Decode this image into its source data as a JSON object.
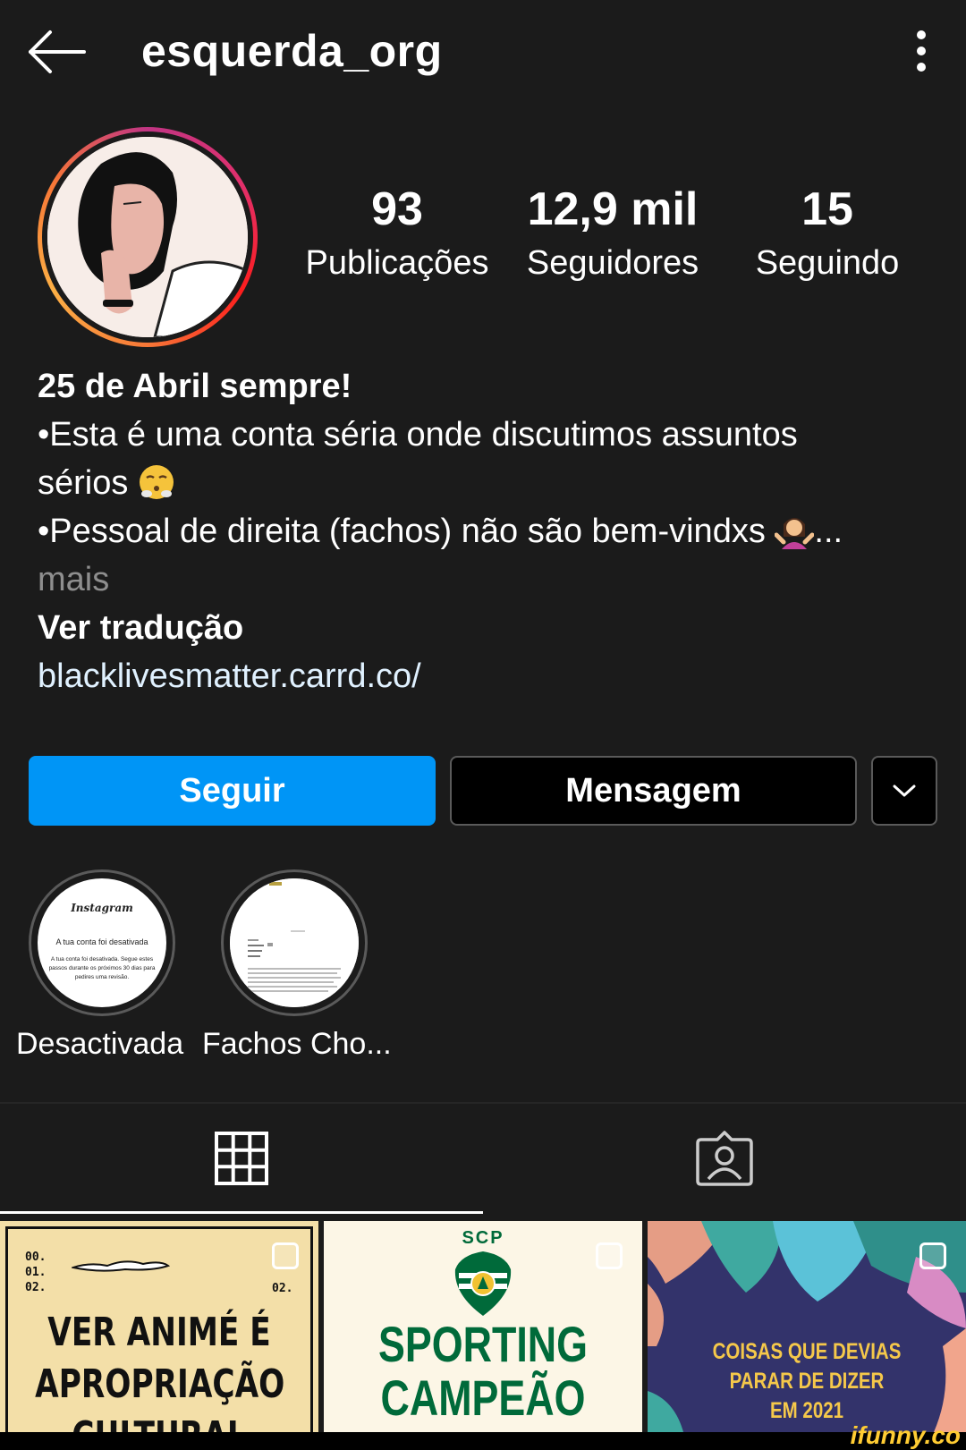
{
  "header": {
    "username": "esquerda_org",
    "back_icon": "arrow-left-icon",
    "menu_icon": "more-vertical-icon"
  },
  "stats": [
    {
      "value": "93",
      "label": "Publicações"
    },
    {
      "value": "12,9 mil",
      "label": "Seguidores"
    },
    {
      "value": "15",
      "label": "Seguindo"
    }
  ],
  "bio": {
    "name": "25 de Abril sempre!",
    "line1": "•Esta é uma conta séria onde discutimos assuntos",
    "line2": "sérios",
    "line3": "•Pessoal de direita (fachos) não são bem-vindxs",
    "ellipsis": "...",
    "more": "mais",
    "translate": "Ver tradução",
    "link": "blacklivesmatter.carrd.co/"
  },
  "actions": {
    "follow": "Seguir",
    "message": "Mensagem",
    "dropdown_icon": "chevron-down-icon"
  },
  "highlights": [
    {
      "label": "Desactivada",
      "thumb_title": "Instagram",
      "thumb_heading": "A tua conta foi desativada",
      "thumb_body": "A tua conta foi desativada. Segue estes passos durante os próximos 30 dias para pedires uma revisão."
    },
    {
      "label": "Fachos Cho..."
    }
  ],
  "tabs": [
    {
      "icon": "grid-icon",
      "active": true
    },
    {
      "icon": "tagged-person-icon",
      "active": false
    }
  ],
  "posts": [
    {
      "header_nums": [
        "00.",
        "01.",
        "02."
      ],
      "side_num": "02.",
      "line1": "VER ANIMÉ É",
      "line2": "APROPRIAÇÃO",
      "line3": "CULTURAL"
    },
    {
      "badge": "SCP",
      "line1": "SPORTING",
      "line2": "CAMPEÃO"
    },
    {
      "line1": "COISAS QUE DEVIAS",
      "line2": "PARAR DE DIZER",
      "line3": "EM 2021"
    }
  ],
  "watermark": "ifunny.co",
  "colors": {
    "follow_blue": "#0095f6",
    "background": "#1b1b1b",
    "link": "#e0f1ff"
  }
}
